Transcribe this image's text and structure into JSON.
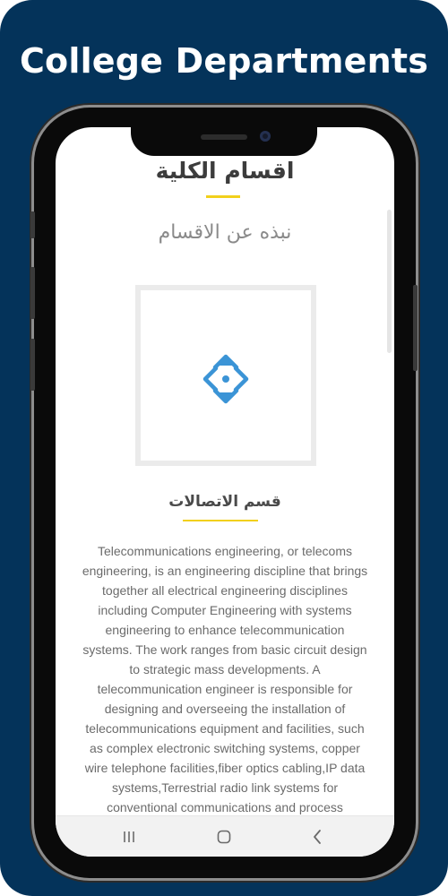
{
  "banner": {
    "heading": "College Departments",
    "background_color": "#04335a"
  },
  "page": {
    "title": "اقسام الكلية",
    "subtitle": "نبذه عن الاقسام",
    "accent_color": "#f2d01b"
  },
  "department": {
    "title": "قسم الاتصالات",
    "image_icon": "move-arrows-icon",
    "icon_color": "#3b94d6",
    "description": "Telecommunications engineering, or telecoms engineering, is an engineering discipline that brings together all electrical engineering disciplines including Computer Engineering with systems engineering to enhance telecommunication systems. The work ranges from basic circuit design to strategic mass developments. A telecommunication engineer is responsible for designing and overseeing the installation of telecommunications equipment and facilities, such as complex electronic switching systems, copper wire telephone facilities,fiber optics cabling,IP data systems,Terrestrial radio link systems for conventional communications and process"
  },
  "navbar": {
    "recents_icon": "recents-icon",
    "home_icon": "home-icon",
    "back_icon": "back-icon"
  }
}
